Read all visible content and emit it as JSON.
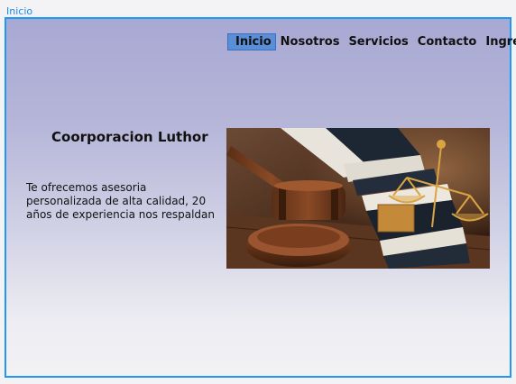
{
  "page_label": "Inicio",
  "nav": {
    "items": [
      "Inicio",
      "Nosotros",
      "Servicios",
      "Contacto",
      "Ingresar"
    ],
    "active_index": 0
  },
  "hero": {
    "title": "Coorporacion Luthor",
    "description": "Te ofrecemos asesoria personalizada de alta calidad, 20 años de experiencia nos respaldan",
    "image": "gavel-scales-books-photo"
  },
  "colors": {
    "frame_border": "#2196f3",
    "active_nav_bg": "#5a8fd8",
    "gradient_top": "#a8a9d3",
    "gradient_bottom": "#f2f2f5"
  }
}
